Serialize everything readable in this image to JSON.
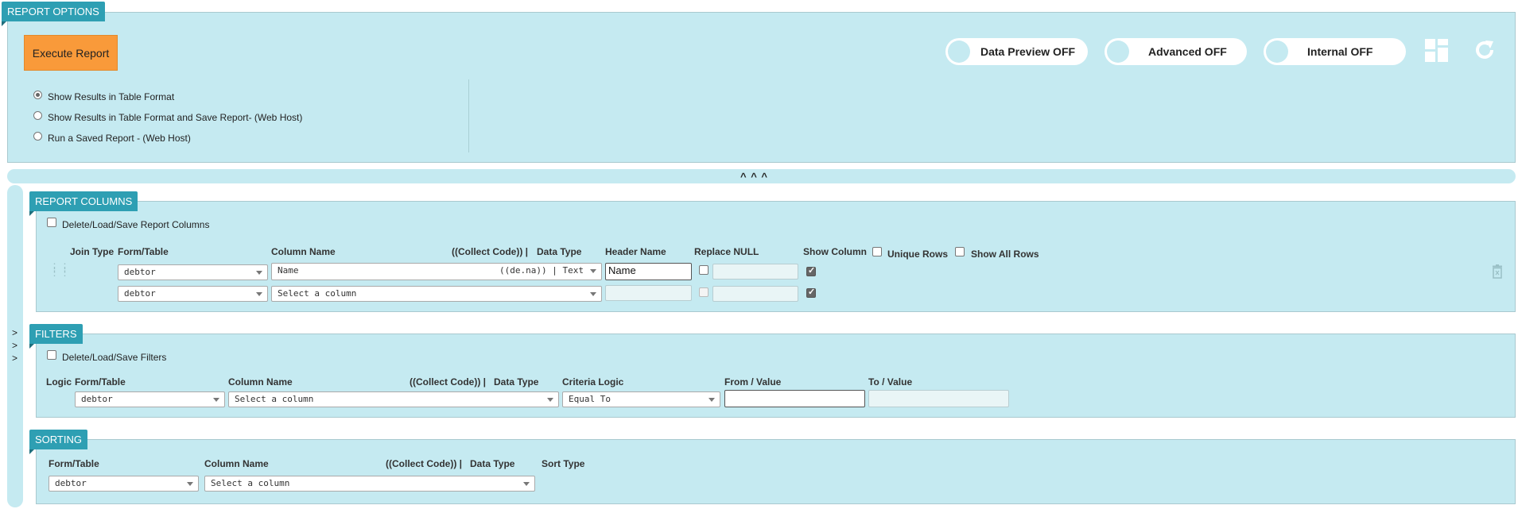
{
  "report_options": {
    "tab_label": "REPORT OPTIONS",
    "execute_label": "Execute Report",
    "toggles": [
      {
        "label": "Data Preview OFF"
      },
      {
        "label": "Advanced OFF"
      },
      {
        "label": "Internal OFF"
      }
    ],
    "radios": [
      {
        "label": "Show Results in Table Format",
        "checked": true
      },
      {
        "label": "Show Results in Table Format and Save Report- (Web Host)",
        "checked": false
      },
      {
        "label": "Run a Saved Report - (Web Host)",
        "checked": false
      }
    ],
    "collapse_label": "^ ^ ^"
  },
  "report_columns": {
    "tab_label": "REPORT COLUMNS",
    "delete_load_save_label": "Delete/Load/Save Report Columns",
    "headers": {
      "join_type": "Join Type",
      "form_table": "Form/Table",
      "column_name": "Column Name",
      "collect_code": "((Collect Code)) |",
      "data_type": "Data Type",
      "header_name": "Header Name",
      "replace_null": "Replace NULL",
      "show_column": "Show Column",
      "unique_rows": "Unique Rows",
      "show_all_rows": "Show All Rows"
    },
    "rows": [
      {
        "table": "debtor",
        "column": "Name",
        "code": "((de.na)) | Text",
        "header_name": "Name",
        "show": true
      },
      {
        "table": "debtor",
        "column": "Select a column",
        "code": "",
        "header_name": "",
        "show": true
      }
    ]
  },
  "filters": {
    "tab_label": "FILTERS",
    "delete_load_save_label": "Delete/Load/Save Filters",
    "headers": {
      "logic": "Logic",
      "form_table": "Form/Table",
      "column_name": "Column Name",
      "collect_code": "((Collect Code)) |",
      "data_type": "Data Type",
      "criteria_logic": "Criteria Logic",
      "from_value": "From / Value",
      "to_value": "To / Value"
    },
    "row": {
      "table": "debtor",
      "column": "Select a column",
      "criteria": "Equal To",
      "from": "",
      "to": ""
    }
  },
  "sorting": {
    "tab_label": "SORTING",
    "headers": {
      "form_table": "Form/Table",
      "column_name": "Column Name",
      "collect_code": "((Collect Code)) |",
      "data_type": "Data Type",
      "sort_type": "Sort Type"
    },
    "row": {
      "table": "debtor",
      "column": "Select a column"
    }
  },
  "side_arrows": [
    ">",
    ">",
    ">"
  ]
}
